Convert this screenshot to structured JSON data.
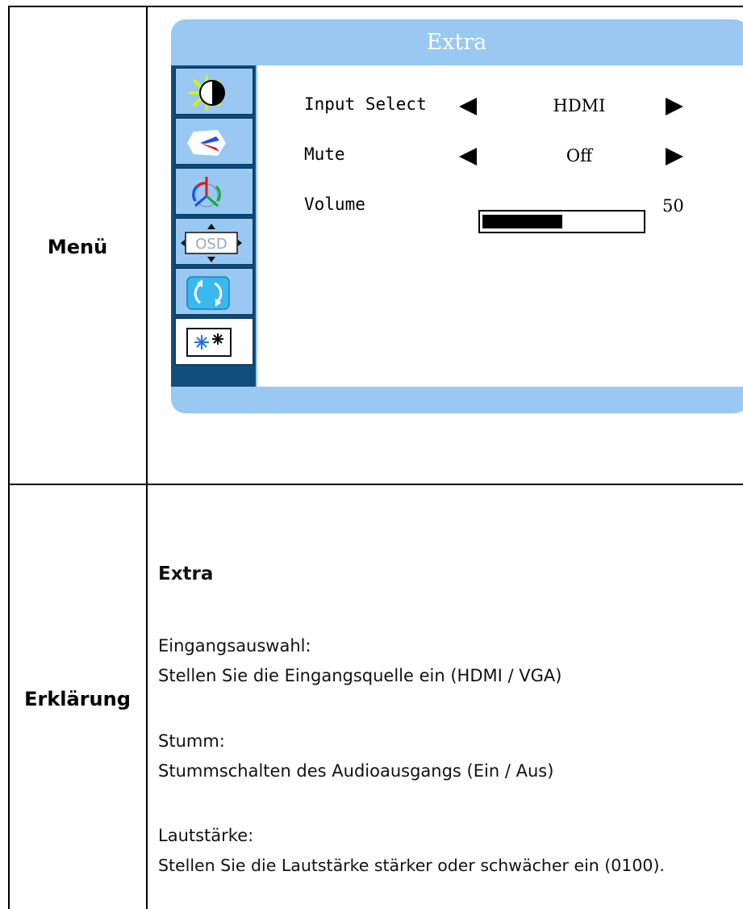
{
  "table": {
    "row1_label": "Menü",
    "row2_label": "Erklärung"
  },
  "osd": {
    "title": "Extra",
    "colors": {
      "frame": "#99c8f3",
      "sidebar": "#124d7c",
      "content": "#ffffff"
    },
    "side_icons": [
      "brightness-contrast-icon",
      "picture-image-icon",
      "color-rgb-icon",
      "osd-settings-icon",
      "reset-icon",
      "extra-icon"
    ],
    "selected_side_icon": "extra-icon",
    "osd_icon_label": "OSD",
    "rows": [
      {
        "label": "Input Select",
        "value": "HDMI"
      },
      {
        "label": "Mute",
        "value": "Off"
      },
      {
        "label": "Volume",
        "value": "50"
      }
    ],
    "volume_level": 0.5
  },
  "explanation": {
    "title": "Extra",
    "items": [
      {
        "heading": "Eingangsauswahl:",
        "text": "Stellen Sie die Eingangsquelle ein (HDMI / VGA)"
      },
      {
        "heading": "Stumm:",
        "text": "Stummschalten des Audioausgangs (Ein / Aus)"
      },
      {
        "heading": "Lautstärke:",
        "text": "Stellen Sie die Lautstärke stärker oder schwächer ein (0100)."
      }
    ]
  }
}
